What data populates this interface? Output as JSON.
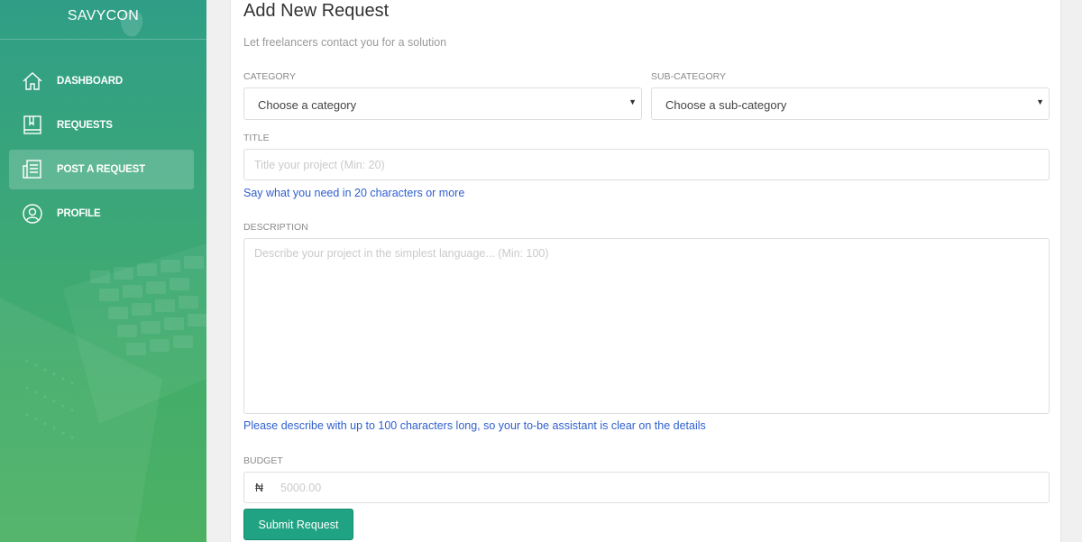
{
  "colors": {
    "accent": "#1fa383",
    "hint_blue": "#2f5fcf",
    "sidebar_top": "#2f9e86",
    "sidebar_bottom": "#4cb163"
  },
  "sidebar": {
    "brand": "SAVYCON",
    "items": [
      {
        "label": "DASHBOARD",
        "icon": "house-icon"
      },
      {
        "label": "REQUESTS",
        "icon": "book-icon"
      },
      {
        "label": "POST A REQUEST",
        "icon": "form-icon",
        "active": true
      },
      {
        "label": "PROFILE",
        "icon": "user-icon"
      }
    ]
  },
  "main": {
    "title": "Add New Request",
    "subtitle": "Let freelancers contact you for a solution",
    "category": {
      "label": "CATEGORY",
      "value": "Choose a category"
    },
    "subcategory": {
      "label": "SUB-CATEGORY",
      "value": "Choose a sub-category"
    },
    "title_field": {
      "label": "TITLE",
      "placeholder": "Title your project (Min: 20)",
      "hint": "Say what you need in 20 characters or more"
    },
    "description": {
      "label": "DESCRIPTION",
      "placeholder": "Describe your project in the simplest language... (Min: 100)",
      "hint": "Please describe with up to 100 characters long, so your to-be assistant is clear on the details"
    },
    "budget": {
      "label": "BUDGET",
      "currency": "₦",
      "placeholder": "5000.00"
    },
    "submit_label": "Submit Request"
  }
}
